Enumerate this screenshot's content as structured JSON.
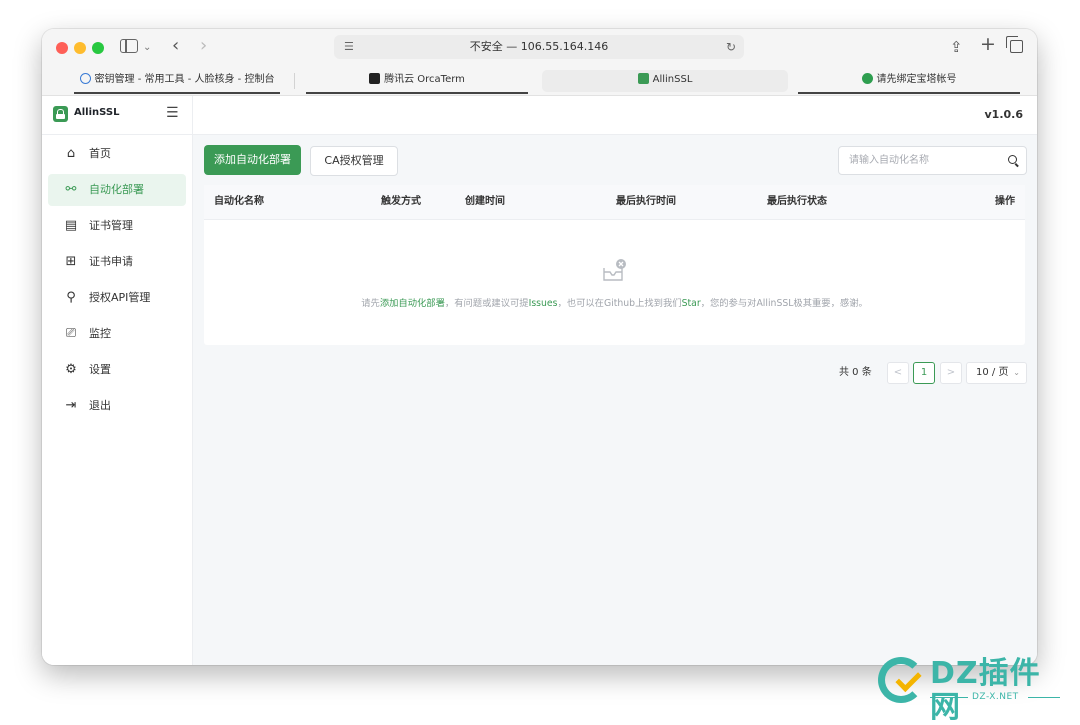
{
  "browser": {
    "address": "不安全 — 106.55.164.146",
    "tabs": [
      {
        "label": "密钥管理 - 常用工具 - 人脸核身 - 控制台",
        "icon": "cloud-icon"
      },
      {
        "label": "腾讯云 OrcaTerm",
        "icon": "terminal-icon"
      },
      {
        "label": "AllinSSL",
        "icon": "allinssl-logo-icon"
      },
      {
        "label": "请先绑定宝塔帐号",
        "icon": "bt-panel-icon"
      }
    ]
  },
  "app": {
    "name": "AllinSSL",
    "version": "v1.0.6",
    "accent": "#3b9a55"
  },
  "sidebar": {
    "items": [
      {
        "label": "首页",
        "icon": "home-icon"
      },
      {
        "label": "自动化部署",
        "icon": "workflow-icon",
        "active": true
      },
      {
        "label": "证书管理",
        "icon": "certificate-icon"
      },
      {
        "label": "证书申请",
        "icon": "add-square-icon"
      },
      {
        "label": "授权API管理",
        "icon": "api-link-icon"
      },
      {
        "label": "监控",
        "icon": "monitor-icon"
      },
      {
        "label": "设置",
        "icon": "gear-icon"
      },
      {
        "label": "退出",
        "icon": "logout-icon"
      }
    ]
  },
  "toolbar": {
    "add_label": "添加自动化部署",
    "ca_label": "CA授权管理",
    "search_placeholder": "请输入自动化名称"
  },
  "table": {
    "columns": [
      "自动化名称",
      "触发方式",
      "创建时间",
      "最后执行时间",
      "最后执行状态",
      "操作"
    ],
    "rows": [],
    "empty": {
      "pre": "请先",
      "link1": "添加自动化部署",
      "mid1": "，有问题或建议可提",
      "link2": "Issues",
      "mid2": "，也可以在Github上找到我们",
      "link3": "Star",
      "post": "，您的参与对AllinSSL极其重要，感谢。"
    }
  },
  "pagination": {
    "total": "共 0 条",
    "prev": "<",
    "page": "1",
    "next": ">",
    "page_size": "10 / 页"
  },
  "watermark": {
    "title": "DZ插件网",
    "subtitle": "DZ-X.NET"
  }
}
